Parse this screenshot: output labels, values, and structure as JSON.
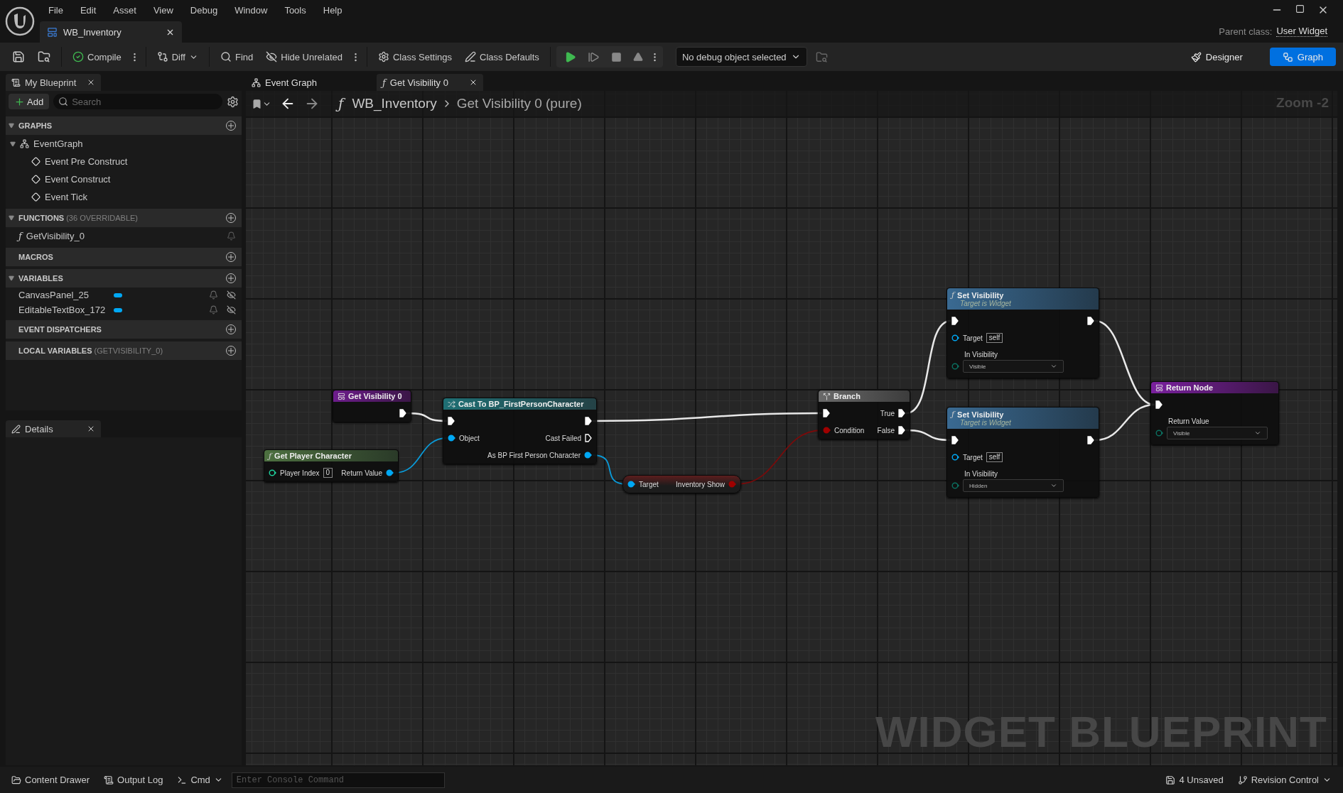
{
  "menu": [
    "File",
    "Edit",
    "Asset",
    "View",
    "Debug",
    "Window",
    "Tools",
    "Help"
  ],
  "document_tabs": [
    {
      "label": "WB_Inventory",
      "selected": true
    }
  ],
  "parent_class": {
    "label": "Parent class:",
    "value": "User Widget"
  },
  "toolbar": {
    "buttons": [
      {
        "label": "Compile",
        "options_menu": true
      },
      {
        "label": "Diff",
        "dropdown": true
      },
      {
        "label": "Find"
      },
      {
        "label": "Hide Unrelated",
        "options_menu": true
      },
      {
        "label": "Class Settings"
      },
      {
        "label": "Class Defaults"
      }
    ],
    "debug_select": {
      "value": "No debug object selected"
    },
    "modes": [
      {
        "label": "Designer",
        "selected": false
      },
      {
        "label": "Graph",
        "selected": true
      }
    ]
  },
  "my_blueprint": {
    "tab": {
      "label": "My Blueprint",
      "closable": true
    },
    "add_label": "Add",
    "search_placeholder": "Search",
    "sections": [
      {
        "title": "GRAPHS",
        "expanded": true,
        "items": [
          {
            "label": "EventGraph",
            "kind": "graph",
            "expanded": true,
            "children": [
              {
                "label": "Event Pre Construct",
                "kind": "event"
              },
              {
                "label": "Event Construct",
                "kind": "event"
              },
              {
                "label": "Event Tick",
                "kind": "event"
              }
            ]
          }
        ]
      },
      {
        "title": "FUNCTIONS",
        "note": "(36 OVERRIDABLE)",
        "expanded": true,
        "items": [
          {
            "label": "GetVisibility_0",
            "kind": "function",
            "glyph": "ƒ"
          }
        ]
      },
      {
        "title": "MACROS"
      },
      {
        "title": "VARIABLES",
        "expanded": true,
        "items": [
          {
            "label": "CanvasPanel_25",
            "kind": "variable",
            "color": "#00a8f4"
          },
          {
            "label": "EditableTextBox_172",
            "kind": "variable",
            "color": "#00a8f4"
          }
        ]
      },
      {
        "title": "EVENT DISPATCHERS"
      },
      {
        "title": "LOCAL VARIABLES",
        "note": "(GETVISIBILITY_0)"
      }
    ]
  },
  "details_tab": {
    "label": "Details",
    "closable": true
  },
  "graph_tabs": [
    {
      "label": "Event Graph",
      "selected": false,
      "closable": false
    },
    {
      "label": "Get Visibility 0",
      "glyph": "ƒ",
      "selected": true,
      "closable": true
    }
  ],
  "breadcrumb": {
    "glyph": "ƒ",
    "items": [
      "WB_Inventory",
      "Get Visibility 0 (pure)"
    ]
  },
  "zoom_label": "Zoom -2",
  "watermark": "WIDGET BLUEPRINT",
  "graph": {
    "nodes": [
      {
        "kind": "entry",
        "title": "Get Visibility 0",
        "rows": [
          {
            "right": {
              "kind": "exec",
              "connected": true
            }
          }
        ]
      },
      {
        "kind": "cast",
        "title": "Cast To BP_FirstPersonCharacter",
        "rows": [
          {
            "left": {
              "kind": "exec",
              "connected": true
            },
            "right": {
              "kind": "exec",
              "connected": true
            }
          },
          {
            "left": {
              "kind": "object",
              "label": "Object",
              "connected": true
            },
            "right": {
              "kind": "exec",
              "label": "Cast Failed",
              "connected": false
            }
          },
          {
            "right": {
              "kind": "object",
              "label": "As BP First Person Character",
              "connected": true
            }
          }
        ]
      },
      {
        "kind": "pure_function",
        "glyph": "ƒ",
        "title": "Get Player Character",
        "rows": [
          {
            "left": {
              "kind": "int",
              "label": "Player Index",
              "value": "0",
              "connected": false
            },
            "right": {
              "kind": "object",
              "label": "Return Value",
              "connected": true
            }
          }
        ]
      },
      {
        "kind": "variable",
        "rows": [
          {
            "left": {
              "kind": "object",
              "label": "Target",
              "connected": true
            },
            "right": {
              "kind": "bool",
              "label": "Inventory Show",
              "connected": true
            }
          }
        ]
      },
      {
        "kind": "branch",
        "title": "Branch",
        "rows": [
          {
            "left": {
              "kind": "exec",
              "connected": true
            },
            "right": {
              "kind": "exec",
              "label": "True",
              "connected": true
            }
          },
          {
            "left": {
              "kind": "bool",
              "label": "Condition",
              "connected": true
            },
            "right": {
              "kind": "exec",
              "label": "False",
              "connected": true
            }
          }
        ]
      },
      {
        "kind": "function",
        "glyph": "ƒ",
        "title": "Set Visibility",
        "subtitle": "Target is Widget",
        "rows": [
          {
            "left": {
              "kind": "exec",
              "connected": true
            },
            "right": {
              "kind": "exec",
              "connected": true
            }
          },
          {
            "left": {
              "kind": "object",
              "label": "Target",
              "value": "self",
              "connected": false
            }
          },
          {
            "left": {
              "kind": "enum",
              "label": "In Visibility",
              "option": "Visible",
              "connected": false
            }
          }
        ]
      },
      {
        "kind": "function",
        "glyph": "ƒ",
        "title": "Set Visibility",
        "subtitle": "Target is Widget",
        "rows": [
          {
            "left": {
              "kind": "exec",
              "connected": true
            },
            "right": {
              "kind": "exec",
              "connected": true
            }
          },
          {
            "left": {
              "kind": "object",
              "label": "Target",
              "value": "self",
              "connected": false
            }
          },
          {
            "left": {
              "kind": "enum",
              "label": "In Visibility",
              "option": "Hidden",
              "connected": false
            }
          }
        ]
      },
      {
        "kind": "return",
        "title": "Return Node",
        "rows": [
          {
            "left": {
              "kind": "exec",
              "connected": true
            }
          },
          {
            "left": {
              "kind": "enum",
              "label": "Return Value",
              "option": "Visible",
              "connected": false
            }
          }
        ]
      }
    ]
  },
  "status_bar": {
    "left": [
      {
        "label": "Content Drawer"
      },
      {
        "label": "Output Log"
      }
    ],
    "cmd": {
      "label": "Cmd",
      "placeholder": "Enter Console Command"
    },
    "right": [
      {
        "label": "4 Unsaved",
        "dropdown": false
      },
      {
        "label": "Revision Control",
        "dropdown": true
      }
    ]
  }
}
